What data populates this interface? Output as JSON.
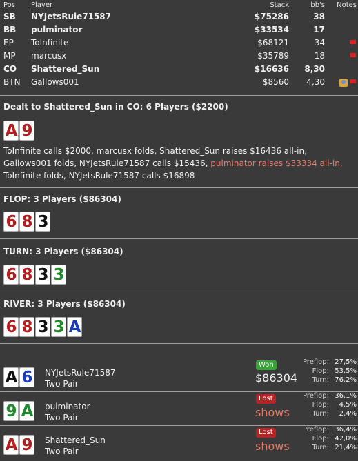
{
  "header": {
    "pos": "Pos",
    "player": "Player",
    "stack": "Stack",
    "bbs": "bb's",
    "notes": "Notes"
  },
  "players": [
    {
      "pos": "SB",
      "name": "NYJetsRule71587",
      "stack": "$75286",
      "bbs": "38",
      "bold": true,
      "notes": []
    },
    {
      "pos": "BB",
      "name": "pulminator",
      "stack": "$33534",
      "bbs": "17",
      "bold": true,
      "notes": []
    },
    {
      "pos": "EP",
      "name": "ToInfinite",
      "stack": "$68121",
      "bbs": "34",
      "bold": false,
      "notes": [
        "flag-icon"
      ]
    },
    {
      "pos": "MP",
      "name": "marcusx",
      "stack": "$35789",
      "bbs": "18",
      "bold": false,
      "notes": [
        "flag-icon"
      ]
    },
    {
      "pos": "CO",
      "name": "Shattered_Sun",
      "stack": "$16636",
      "bbs": "8,30",
      "bold": true,
      "notes": []
    },
    {
      "pos": "BTN",
      "name": "Gallows001",
      "stack": "$8560",
      "bbs": "4,30",
      "bold": false,
      "notes": [
        "person-icon",
        "flag-icon"
      ]
    }
  ],
  "deal": {
    "title": "Dealt to Shattered_Sun in CO: 6 Players ($2200)",
    "cards": [
      {
        "rank": "A",
        "suit": "hearts"
      },
      {
        "rank": "9",
        "suit": "hearts"
      }
    ]
  },
  "preflop_action": {
    "part1": "ToInfinite calls $2000, marcusx folds, Shattered_Sun raises $16436 all-in, Gallows001 folds, NYJetsRule71587 calls $15436,",
    "highlight": "pulminator raises $33334 all-in,",
    "part2": "ToInfinite folds, NYJetsRule71587 calls $16898"
  },
  "streets": [
    {
      "title": "FLOP: 3 Players ($86304)",
      "cards": [
        {
          "rank": "6",
          "suit": "hearts"
        },
        {
          "rank": "8",
          "suit": "hearts"
        },
        {
          "rank": "3",
          "suit": "spades"
        }
      ]
    },
    {
      "title": "TURN: 3 Players ($86304)",
      "cards": [
        {
          "rank": "6",
          "suit": "hearts"
        },
        {
          "rank": "8",
          "suit": "hearts"
        },
        {
          "rank": "3",
          "suit": "spades"
        },
        {
          "rank": "3",
          "suit": "clubs"
        }
      ]
    },
    {
      "title": "RIVER: 3 Players ($86304)",
      "cards": [
        {
          "rank": "6",
          "suit": "hearts"
        },
        {
          "rank": "8",
          "suit": "hearts"
        },
        {
          "rank": "3",
          "suit": "spades"
        },
        {
          "rank": "3",
          "suit": "clubs"
        },
        {
          "rank": "A",
          "suit": "diamonds"
        }
      ]
    }
  ],
  "results": [
    {
      "name": "NYJetsRule71587",
      "hand": "Two Pair",
      "cards": [
        {
          "rank": "A",
          "suit": "spades"
        },
        {
          "rank": "6",
          "suit": "diamonds"
        }
      ],
      "status": "Won",
      "status_type": "won",
      "amount": "$86304",
      "stats": [
        {
          "k": "Preflop:",
          "v": "27,5%"
        },
        {
          "k": "Flop:",
          "v": "53,5%"
        },
        {
          "k": "Turn:",
          "v": "76,2%"
        }
      ]
    },
    {
      "name": "pulminator",
      "hand": "Two Pair",
      "cards": [
        {
          "rank": "9",
          "suit": "clubs"
        },
        {
          "rank": "A",
          "suit": "clubs"
        }
      ],
      "status": "Lost",
      "status_type": "lost",
      "amount": "shows",
      "stats": [
        {
          "k": "Preflop:",
          "v": "36,1%"
        },
        {
          "k": "Flop:",
          "v": "4,5%"
        },
        {
          "k": "Turn:",
          "v": "2,4%"
        }
      ]
    },
    {
      "name": "Shattered_Sun",
      "hand": "Two Pair",
      "cards": [
        {
          "rank": "A",
          "suit": "hearts"
        },
        {
          "rank": "9",
          "suit": "hearts"
        }
      ],
      "status": "Lost",
      "status_type": "lost",
      "amount": "shows",
      "stats": [
        {
          "k": "Preflop:",
          "v": "36,4%"
        },
        {
          "k": "Flop:",
          "v": "42,0%"
        },
        {
          "k": "Turn:",
          "v": "21,4%"
        }
      ]
    }
  ]
}
